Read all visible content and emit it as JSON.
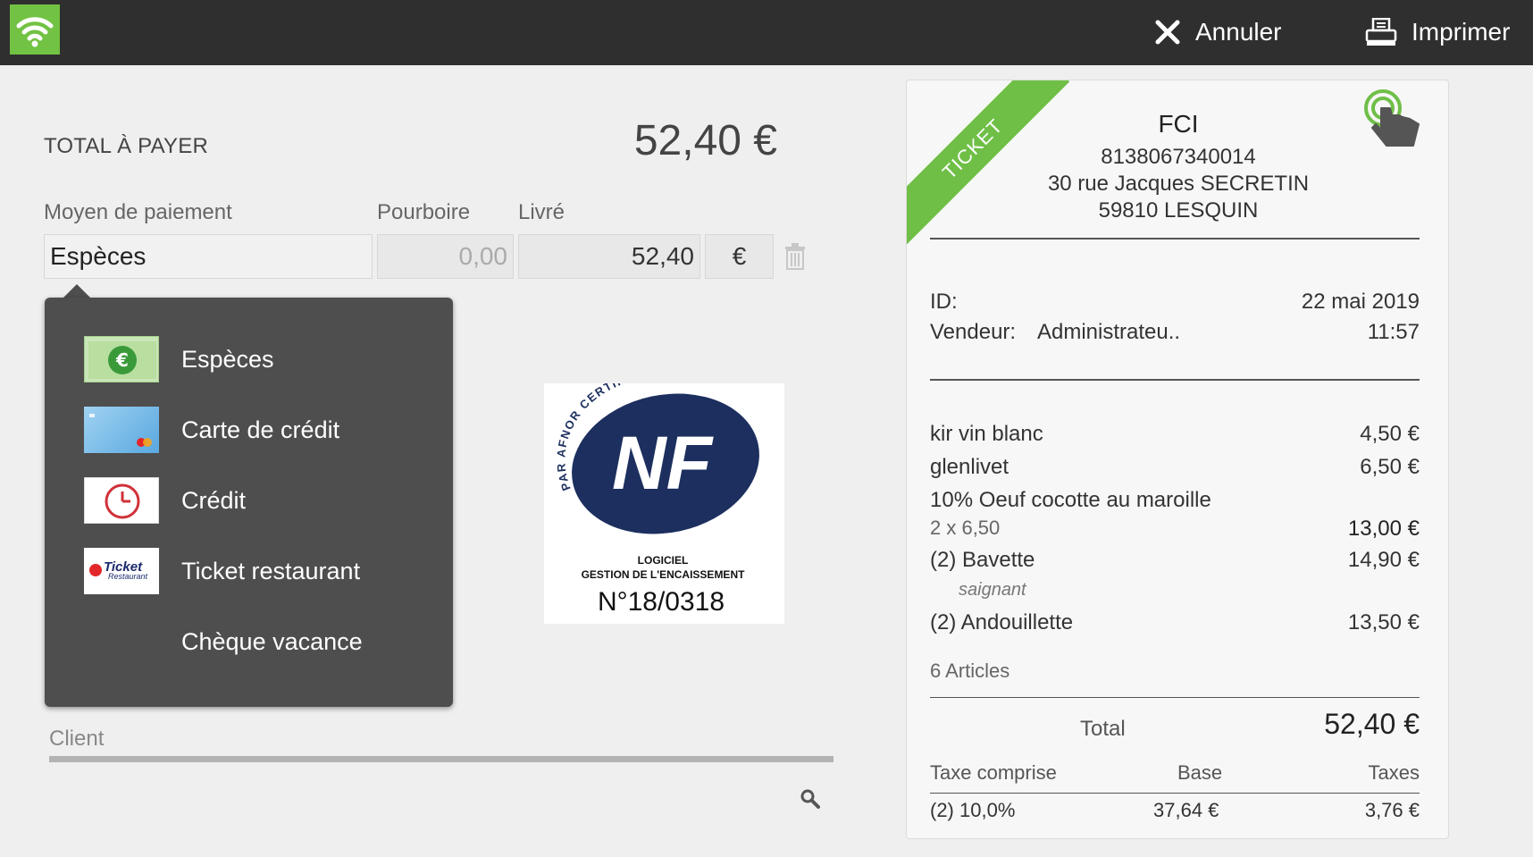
{
  "topbar": {
    "cancel_label": "Annuler",
    "print_label": "Imprimer",
    "accent_color": "#72c243"
  },
  "payment": {
    "total_label": "TOTAL À PAYER",
    "total_value": "52,40 €",
    "method_col": "Moyen de paiement",
    "tip_col": "Pourboire",
    "delivered_col": "Livré",
    "method_value": "Espèces",
    "tip_placeholder": "0,00",
    "delivered_value": "52,40",
    "currency": "€"
  },
  "menu": {
    "items": [
      {
        "label": "Espèces",
        "icon": "cash-icon"
      },
      {
        "label": "Carte de crédit",
        "icon": "credit-card-icon"
      },
      {
        "label": "Crédit",
        "icon": "clock-icon"
      },
      {
        "label": "Ticket restaurant",
        "icon": "ticket-restaurant-icon"
      },
      {
        "label": "Chèque vacance",
        "icon": ""
      }
    ]
  },
  "nf_badge": {
    "arc_text": "PAR AFNOR CERTIFICATION",
    "logo": "NF",
    "line1": "LOGICIEL",
    "line2": "GESTION DE L'ENCAISSEMENT",
    "number": "N°18/0318"
  },
  "client": {
    "label": "Client"
  },
  "ticket": {
    "ribbon": "TICKET",
    "shop_name": "FCI",
    "siret": "8138067340014",
    "address1": "30 rue Jacques SECRETIN",
    "address2": "59810 LESQUIN",
    "id_label": "ID:",
    "date": "22 mai 2019",
    "seller_label": "Vendeur:",
    "seller": "Administrateu..",
    "time": "11:57",
    "lines": [
      {
        "name": "kir vin blanc",
        "price": "4,50 €"
      },
      {
        "name": "glenlivet",
        "price": "6,50 €"
      },
      {
        "name": "10% Oeuf cocotte au maroille",
        "price": ""
      },
      {
        "name": "2 x 6,50",
        "price": "13,00 €"
      },
      {
        "name": "(2) Bavette",
        "price": "14,90 €"
      },
      {
        "name": "saignant",
        "price": ""
      },
      {
        "name": "(2) Andouillette",
        "price": "13,50 €"
      }
    ],
    "articles": "6 Articles",
    "total_label": "Total",
    "total_value": "52,40 €",
    "tax_label": "Taxe comprise",
    "base_label": "Base",
    "taxes_label": "Taxes",
    "tax_row_rate": "(2) 10,0%",
    "tax_row_base": "37,64 €",
    "tax_row_tax": "3,76 €"
  }
}
